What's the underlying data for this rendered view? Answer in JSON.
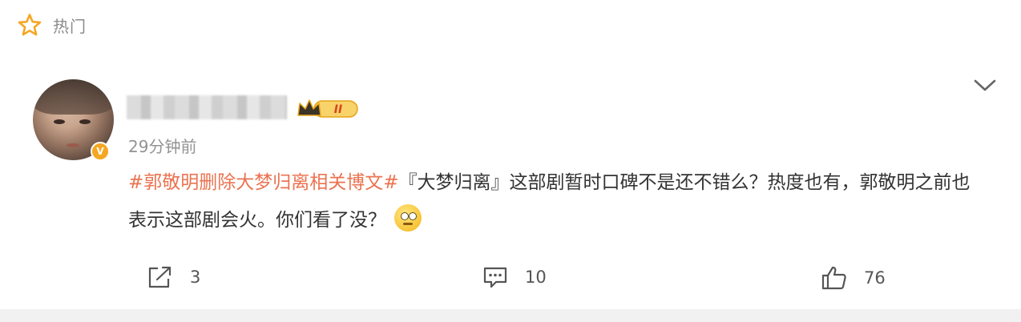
{
  "header": {
    "hot_label": "热门",
    "star_icon": "star-outline-icon",
    "more_icon": "chevron-down-icon"
  },
  "post": {
    "user_badge": "V",
    "vip_level": "II",
    "time": "29分钟前",
    "hashtag": "#郭敬明删除大梦归离相关博文#",
    "text": "『大梦归离』这部剧暂时口碑不是还不错么？热度也有，郭敬明之前也表示这部剧会火。你们看了没？",
    "emoji": "thinking-face-emoji"
  },
  "actions": {
    "share_count": "3",
    "comment_count": "10",
    "like_count": "76"
  },
  "colors": {
    "hashtag": "#eb7350",
    "star": "#f5a623",
    "gold": "#e6a419",
    "muted": "#939393"
  }
}
